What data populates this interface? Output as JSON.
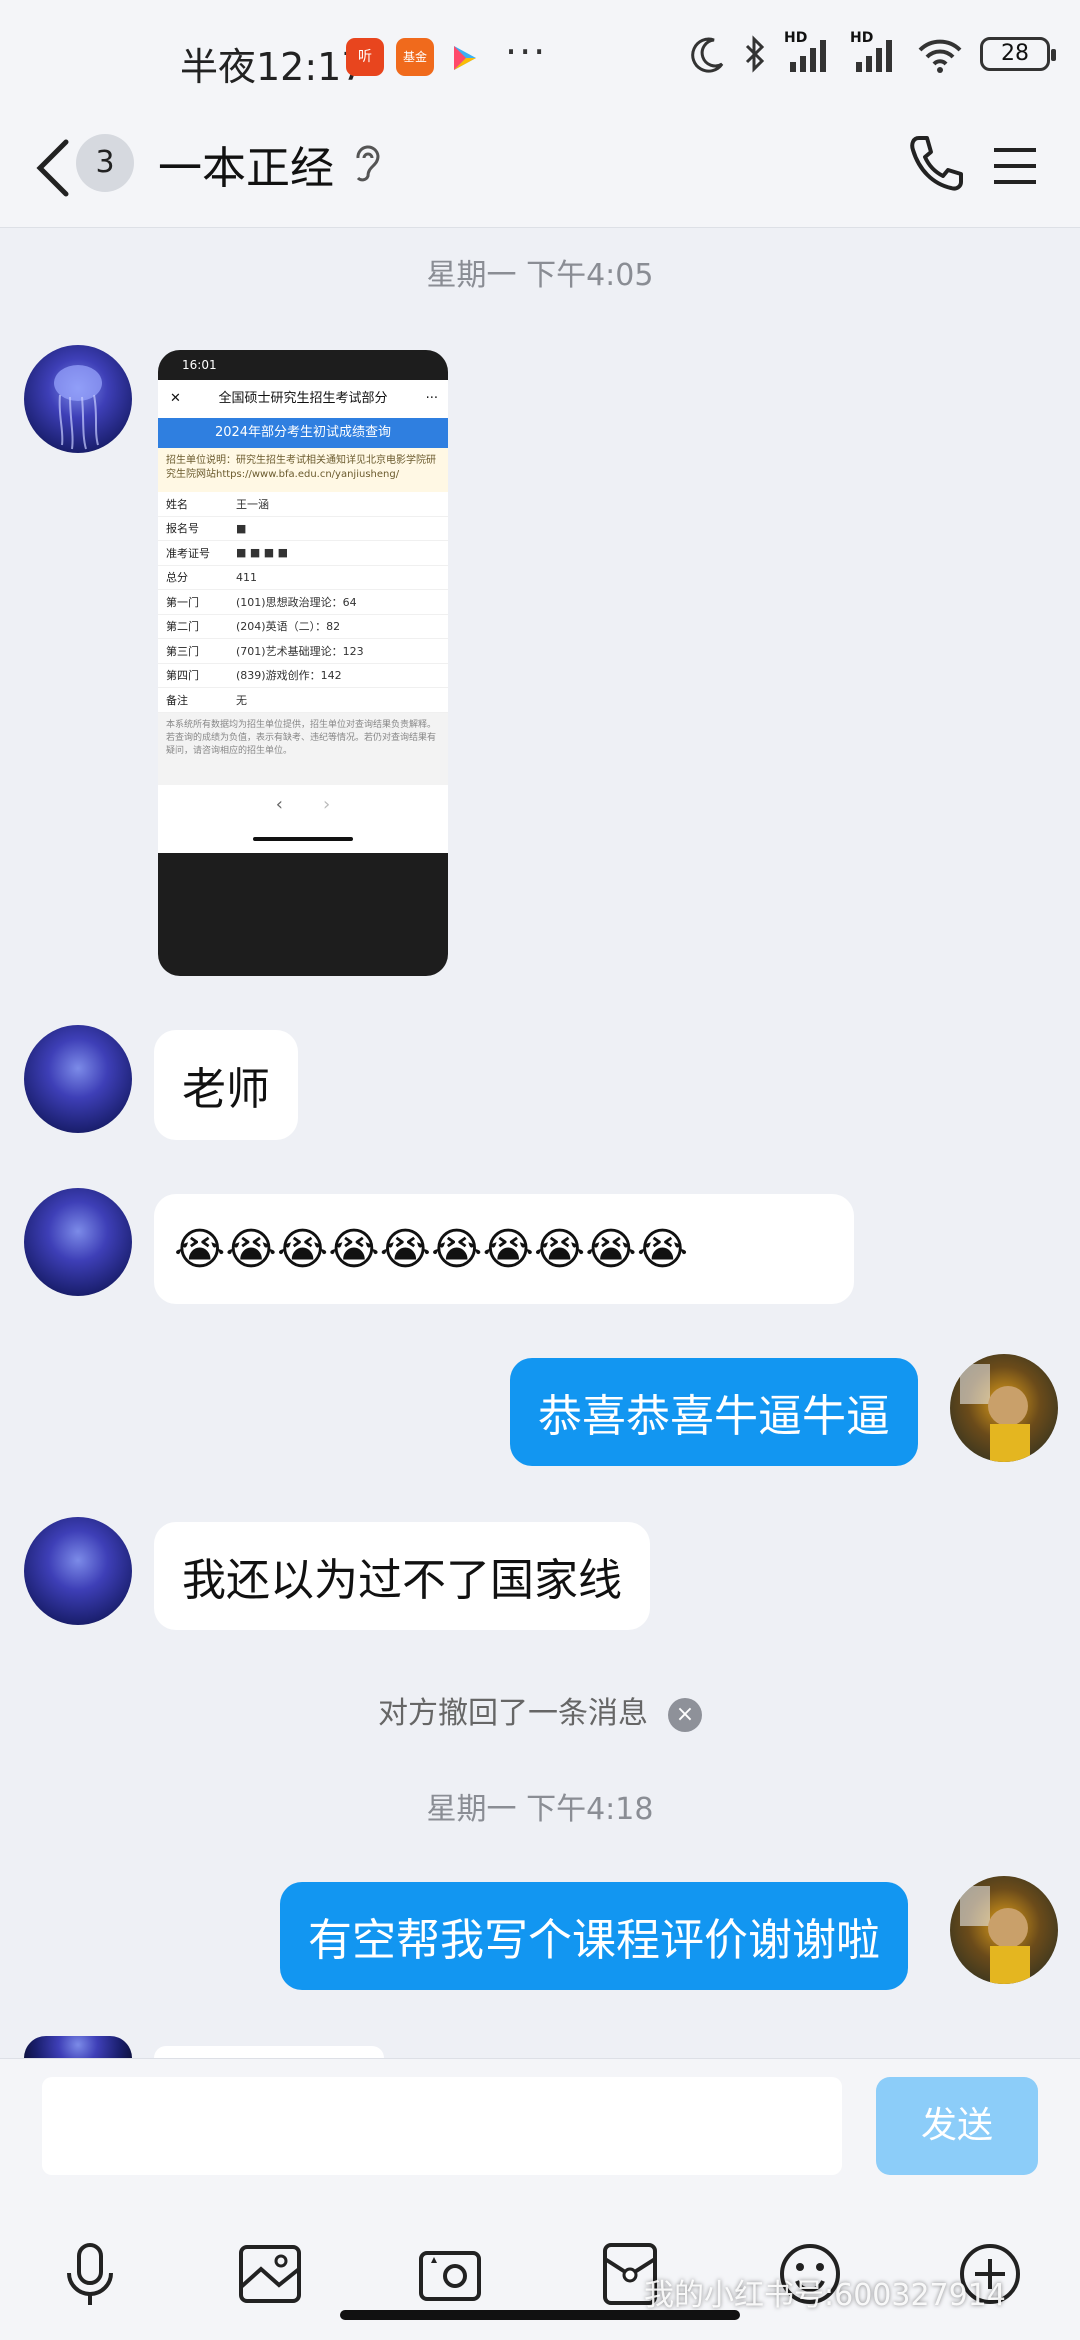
{
  "status_bar": {
    "time": "半夜12:17",
    "badge1": "听",
    "badge2": "基金",
    "more": "···",
    "battery": "28",
    "signal1": "HD",
    "signal2": "HD"
  },
  "header": {
    "unread_count": "3",
    "title": "一本正经"
  },
  "messages": {
    "timestamp1": "星期一 下午4:05",
    "screenshot": {
      "status_time": "16:01",
      "nav_title": "全国硕士研究生招生考试部分",
      "blue_title": "2024年部分考生初试成绩查询",
      "note": "招生单位说明：研究生招生考试相关通知详见北京电影学院研究生院网站https://www.bfa.edu.cn/yanjiusheng/",
      "rows": [
        {
          "k": "姓名",
          "v": "王一涵"
        },
        {
          "k": "报名号",
          "v": "■"
        },
        {
          "k": "准考证号",
          "v": "■     ■    ■    ■"
        },
        {
          "k": "总分",
          "v": "411"
        },
        {
          "k": "第一门",
          "v": "(101)思想政治理论：64"
        },
        {
          "k": "第二门",
          "v": "(204)英语（二）：82"
        },
        {
          "k": "第三门",
          "v": "(701)艺术基础理论：123"
        },
        {
          "k": "第四门",
          "v": "(839)游戏创作：142"
        },
        {
          "k": "备注",
          "v": "无"
        }
      ],
      "footer": "本系统所有数据均为招生单位提供，招生单位对查询结果负责解释。若查询的成绩为负值，表示有缺考、违纪等情况。若仍对查询结果有疑问，请咨询相应的招生单位。"
    },
    "msg_teacher": "老师",
    "msg_crying": "😭😭😭😭😭😭😭😭😭😭",
    "msg_congrats": "恭喜恭喜牛逼牛逼",
    "msg_national": "我还以为过不了国家线",
    "recall_notice": "对方撤回了一条消息",
    "timestamp2": "星期一 下午4:18",
    "msg_request": "有空帮我写个课程评价谢谢啦"
  },
  "input_bar": {
    "send_label": "发送",
    "watermark": "我的小红书号:600327914"
  },
  "icons": [
    "back-icon",
    "hearing-icon",
    "phone-icon",
    "menu-icon",
    "microphone-icon",
    "image-icon",
    "camera-icon",
    "red-packet-icon",
    "emoji-icon",
    "plus-icon"
  ]
}
